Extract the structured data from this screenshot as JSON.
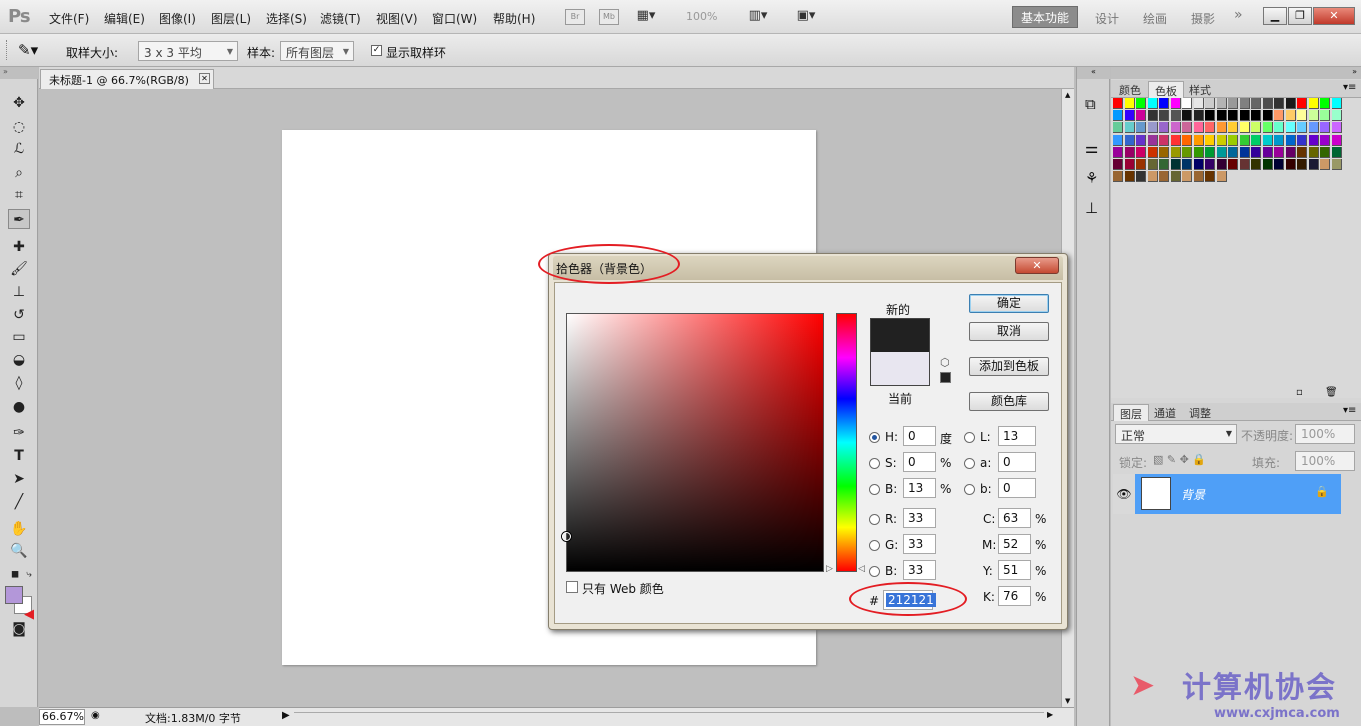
{
  "menubar": {
    "logo": "Ps",
    "items": [
      "文件(F)",
      "编辑(E)",
      "图像(I)",
      "图层(L)",
      "选择(S)",
      "滤镜(T)",
      "视图(V)",
      "窗口(W)",
      "帮助(H)"
    ],
    "br": "Br",
    "mb": "Mb",
    "zoom": "100%",
    "workspaces": {
      "active": "基本功能",
      "others": [
        "设计",
        "绘画",
        "摄影"
      ],
      "more": "»"
    }
  },
  "options": {
    "sample_size_label": "取样大小:",
    "sample_size_value": "3 x 3 平均",
    "sample_label": "样本:",
    "sample_value": "所有图层",
    "show_ring_label": "显示取样环"
  },
  "document": {
    "tab_title": "未标题-1 @ 66.7%(RGB/8)",
    "zoom": "66.67%",
    "doc_info": "文档:1.83M/0 字节"
  },
  "colors": {
    "foreground": "#b397d9",
    "background": "#ffffff"
  },
  "swatches_panel": {
    "tabs": [
      "颜色",
      "色板",
      "样式"
    ],
    "active": "色板"
  },
  "layers_panel": {
    "tabs": [
      "图层",
      "通道",
      "调整"
    ],
    "blend_mode": "正常",
    "opacity_label": "不透明度:",
    "opacity": "100%",
    "lock_label": "锁定:",
    "fill_label": "填充:",
    "fill": "100%",
    "layer_name": "背景"
  },
  "dialog": {
    "title": "拾色器（背景色）",
    "new_label": "新的",
    "current_label": "当前",
    "new_color": "#212121",
    "current_color": "#e8e6f0",
    "buttons": {
      "ok": "确定",
      "cancel": "取消",
      "add_swatch": "添加到色板",
      "libraries": "颜色库"
    },
    "web_only": "只有 Web 颜色",
    "hsb": {
      "h": "0",
      "s": "0",
      "b": "13",
      "h_unit": "度",
      "s_unit": "%",
      "b_unit": "%"
    },
    "lab": {
      "l": "13",
      "a": "0",
      "b": "0"
    },
    "rgb": {
      "r": "33",
      "g": "33",
      "b": "33"
    },
    "cmyk": {
      "c": "63",
      "m": "52",
      "y": "51",
      "k": "76"
    },
    "hex": "212121",
    "labels": {
      "h": "H:",
      "s": "S:",
      "b": "B:",
      "r": "R:",
      "g": "G:",
      "b2": "B:",
      "l": "L:",
      "a": "a:",
      "lb": "b:",
      "c": "C:",
      "m": "M:",
      "y": "Y:",
      "k": "K:",
      "hash": "#",
      "pct": "%"
    }
  },
  "watermark": {
    "text": "计算机协会",
    "url": "www.cxjmca.com"
  }
}
